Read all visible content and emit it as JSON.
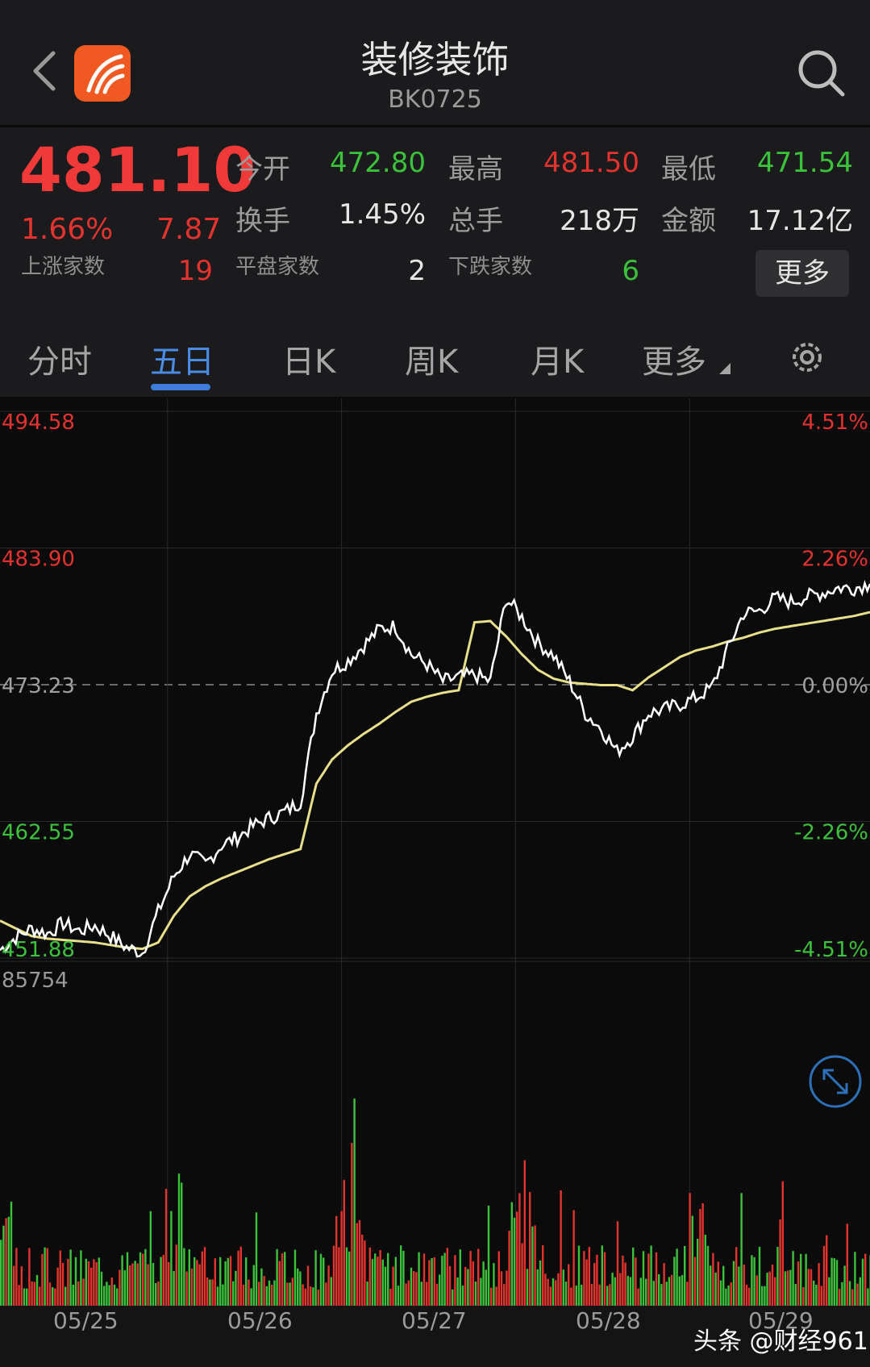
{
  "header": {
    "title": "装修装饰",
    "code": "BK0725"
  },
  "quote": {
    "price": "481.10",
    "change_pct": "1.66%",
    "change": "7.87",
    "open_label": "今开",
    "open": "472.80",
    "high_label": "最高",
    "high": "481.50",
    "low_label": "最低",
    "low": "471.54",
    "turnover_label": "换手",
    "turnover": "1.45%",
    "volume_label": "总手",
    "volume": "218万",
    "amount_label": "金额",
    "amount": "17.12亿",
    "up_label": "上涨家数",
    "up_count": "19",
    "flat_label": "平盘家数",
    "flat_count": "2",
    "down_label": "下跌家数",
    "down_count": "6",
    "more_label": "更多"
  },
  "tabs": [
    "分时",
    "五日",
    "日K",
    "周K",
    "月K",
    "更多"
  ],
  "active_tab": "五日",
  "colors": {
    "up": "#e2332f",
    "down": "#3bc13b",
    "accent": "#4a8be4",
    "avg_line": "#e8df8a"
  },
  "icons": [
    "back-icon",
    "app-logo",
    "search-icon",
    "gear-icon",
    "expand-icon"
  ],
  "chart_data": {
    "type": "line",
    "title": "",
    "x_labels": [
      "05/25",
      "05/26",
      "05/27",
      "05/28",
      "05/29"
    ],
    "price_axis": [
      "494.58",
      "483.90",
      "473.23",
      "462.55",
      "451.88"
    ],
    "pct_axis": [
      "4.51%",
      "2.26%",
      "0.00%",
      "-2.26%",
      "-4.51%"
    ],
    "ylim": [
      451.88,
      494.58
    ],
    "prev_close": 473.23,
    "volume_max_label": "85754",
    "series": [
      {
        "name": "",
        "values": [
          452.5,
          453.5,
          454.2,
          453.8,
          454.6,
          454.0,
          454.4,
          453.6,
          452.7,
          452.3,
          455.5,
          458.3,
          460.0,
          459.2,
          460.7,
          461.3,
          462.2,
          462.8,
          463.3,
          464.1,
          471.0,
          474.3,
          475.1,
          476.3,
          477.6,
          477.8,
          475.6,
          474.8,
          473.5,
          473.8,
          474.0,
          473.5,
          480.0,
          478.5,
          476.5,
          475.5,
          473.5,
          471.0,
          469.8,
          468.0,
          469.2,
          471.0,
          471.3,
          471.7,
          472.2,
          473.0,
          476.0,
          478.8,
          479.0,
          480.0,
          479.7,
          480.1,
          480.4,
          480.8,
          480.8,
          481.1
        ]
      },
      {
        "name": "",
        "values": [
          454.8,
          454.2,
          453.6,
          453.4,
          453.3,
          453.2,
          453.1,
          452.9,
          452.7,
          452.6,
          453.1,
          455.2,
          456.7,
          457.5,
          458.1,
          458.6,
          459.1,
          459.6,
          460.0,
          460.4,
          465.5,
          467.4,
          468.5,
          469.4,
          470.2,
          471.1,
          471.9,
          472.3,
          472.6,
          472.8,
          478.1,
          478.2,
          477.0,
          475.6,
          474.4,
          473.7,
          473.4,
          473.3,
          473.2,
          473.2,
          472.8,
          473.8,
          474.6,
          475.4,
          475.9,
          476.2,
          476.6,
          476.9,
          477.3,
          477.6,
          477.8,
          478.0,
          478.2,
          478.4,
          478.6,
          478.9
        ]
      }
    ]
  }
}
